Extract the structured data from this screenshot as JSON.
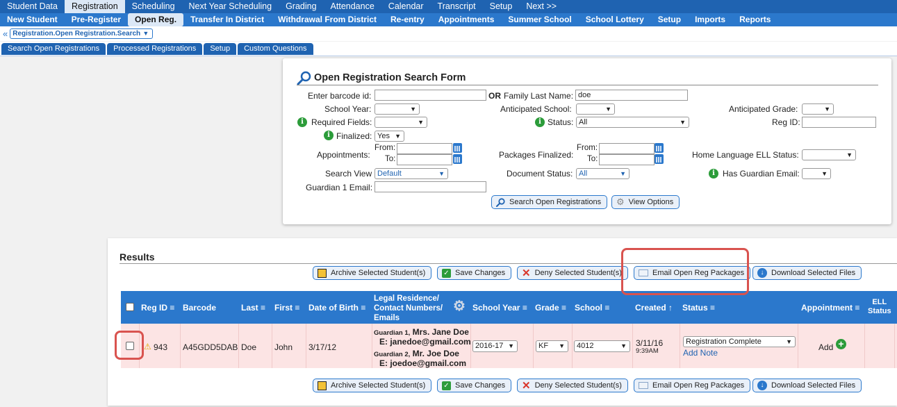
{
  "nav_primary": [
    "Student Data",
    "Registration",
    "Scheduling",
    "Next Year Scheduling",
    "Grading",
    "Attendance",
    "Calendar",
    "Transcript",
    "Setup",
    "Next >>"
  ],
  "nav_primary_active": 1,
  "nav_secondary": [
    "New Student",
    "Pre-Register",
    "Open Reg.",
    "Transfer In District",
    "Withdrawal From District",
    "Re-entry",
    "Appointments",
    "Summer School",
    "School Lottery",
    "Setup",
    "Imports",
    "Reports"
  ],
  "nav_secondary_active": 2,
  "breadcrumb": {
    "select_value": "Registration.Open Registration.Search"
  },
  "tabs": [
    "Search Open Registrations",
    "Processed Registrations",
    "Setup",
    "Custom Questions"
  ],
  "form": {
    "title": "Open Registration Search Form",
    "barcode_label": "Enter barcode id:",
    "or_label": "OR",
    "family_last_name_label": "Family Last Name:",
    "family_last_name_value": "doe",
    "school_year_label": "School Year:",
    "anticipated_school_label": "Anticipated School:",
    "anticipated_grade_label": "Anticipated Grade:",
    "required_fields_label": "Required Fields:",
    "status_label": "Status:",
    "status_value": "All",
    "reg_id_label": "Reg ID:",
    "finalized_label": "Finalized:",
    "finalized_value": "Yes",
    "appointments_label": "Appointments:",
    "from_label": "From:",
    "to_label": "To:",
    "packages_finalized_label": "Packages Finalized:",
    "home_language_label": "Home Language ELL Status:",
    "search_view_label": "Search View",
    "search_view_value": "Default",
    "document_status_label": "Document Status:",
    "document_status_value": "All",
    "has_guardian_email_label": "Has Guardian Email:",
    "guardian1_email_label": "Guardian 1 Email:",
    "search_button": "Search Open Registrations",
    "view_options_button": "View Options"
  },
  "results": {
    "title": "Results",
    "archive_button": "Archive Selected Student(s)",
    "save_button": "Save Changes",
    "deny_button": "Deny Selected Student(s)",
    "email_button": "Email Open Reg Packages",
    "download_button": "Download Selected Files",
    "columns": {
      "reg_id": "Reg ID",
      "barcode": "Barcode",
      "last": "Last",
      "first": "First",
      "dob": "Date of Birth",
      "legal_line1": "Legal Residence/",
      "legal_line2": "Contact Numbers/",
      "legal_line3": "Emails",
      "school_year": "School Year",
      "grade": "Grade",
      "school": "School",
      "created": "Created",
      "status": "Status",
      "appointment": "Appointment",
      "ell_line1": "ELL",
      "ell_line2": "Status"
    },
    "row": {
      "reg_id": "943",
      "barcode": "A45GDD5DAB",
      "last": "Doe",
      "first": "John",
      "dob": "3/17/12",
      "g1_prefix": "Guardian 1,",
      "g1_name": "Mrs. Jane Doe",
      "g1_email": "E: janedoe@gmail.com",
      "g2_prefix": "Guardian 2,",
      "g2_name": "Mr. Joe Doe",
      "g2_email": "E: joedoe@gmail.com",
      "school_year": "2016-17",
      "grade": "KF",
      "school": "4012",
      "created_date": "3/11/16",
      "created_time": "9:39AM",
      "status": "Registration Complete",
      "add_note": "Add Note",
      "appointment_add": "Add"
    }
  },
  "colors": {
    "nav_primary": "#1f63b1",
    "nav_secondary": "#2b78cc",
    "row_bg": "#fce4e4",
    "highlight": "#d9534f",
    "info": "#2c9c3a"
  }
}
